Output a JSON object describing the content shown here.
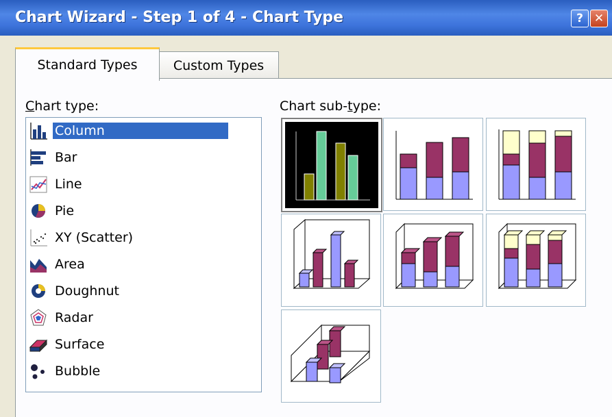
{
  "window": {
    "title": "Chart Wizard - Step 1 of 4 - Chart Type",
    "help_label": "?",
    "close_label": "✕"
  },
  "tabs": [
    {
      "label": "Standard Types",
      "active": true
    },
    {
      "label": "Custom Types",
      "active": false
    }
  ],
  "chart_type": {
    "label_prefix": "C",
    "label_accel": "h",
    "label_rest": "art type:",
    "items": [
      {
        "label": "Column",
        "icon": "column-chart-icon",
        "selected": true
      },
      {
        "label": "Bar",
        "icon": "bar-chart-icon"
      },
      {
        "label": "Line",
        "icon": "line-chart-icon"
      },
      {
        "label": "Pie",
        "icon": "pie-chart-icon"
      },
      {
        "label": "XY (Scatter)",
        "icon": "scatter-chart-icon"
      },
      {
        "label": "Area",
        "icon": "area-chart-icon"
      },
      {
        "label": "Doughnut",
        "icon": "doughnut-chart-icon"
      },
      {
        "label": "Radar",
        "icon": "radar-chart-icon"
      },
      {
        "label": "Surface",
        "icon": "surface-chart-icon"
      },
      {
        "label": "Bubble",
        "icon": "bubble-chart-icon"
      }
    ]
  },
  "sub_type": {
    "label_prefix": "Chart sub-",
    "label_accel": "t",
    "label_rest": "ype:",
    "options": [
      {
        "name": "clustered-column",
        "selected": true
      },
      {
        "name": "stacked-column"
      },
      {
        "name": "100-percent-stacked-column"
      },
      {
        "name": "3d-clustered-column"
      },
      {
        "name": "3d-stacked-column"
      },
      {
        "name": "3d-100-percent-stacked-column"
      },
      {
        "name": "3d-column"
      }
    ]
  },
  "colors": {
    "title_bar": "#3e74dc",
    "selection": "#316ac5",
    "tab_highlight": "#ffc83c",
    "series_blue": "#9999ff",
    "series_maroon": "#993366",
    "series_cream": "#ffffcc",
    "series_olive": "#808000",
    "series_teal": "#66cc99"
  }
}
